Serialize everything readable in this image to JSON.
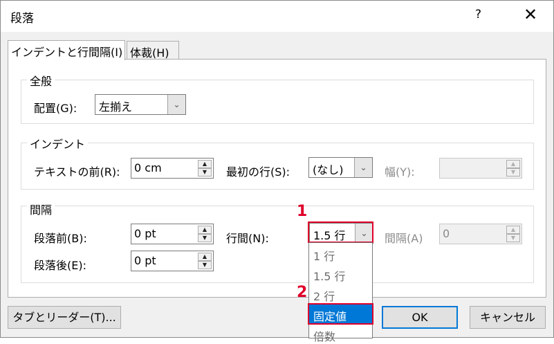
{
  "window": {
    "title": "段落",
    "help": "?",
    "close": "✕"
  },
  "tabs": [
    {
      "label": "インデントと行間隔(I)"
    },
    {
      "label": "体裁(H)"
    }
  ],
  "general": {
    "heading": "全般",
    "alignment_label": "配置(G):",
    "alignment_value": "左揃え"
  },
  "indent": {
    "heading": "インデント",
    "before_text_label": "テキストの前(R):",
    "before_text_value": "0 cm",
    "first_line_label": "最初の行(S):",
    "first_line_value": "(なし)",
    "by_label": "幅(Y):",
    "by_value": ""
  },
  "spacing": {
    "heading": "間隔",
    "before_label": "段落前(B):",
    "before_value": "0 pt",
    "after_label": "段落後(E):",
    "after_value": "0 pt",
    "line_spacing_label": "行間(N):",
    "line_spacing_value": "1.5 行",
    "at_label": "間隔(A)",
    "at_value": "0"
  },
  "line_spacing_options": [
    "1 行",
    "1.5 行",
    "2 行",
    "固定値",
    "倍数"
  ],
  "annotations": {
    "step1": "1",
    "step2": "2"
  },
  "buttons": {
    "tabs": "タブとリーダー(T)...",
    "ok": "OK",
    "cancel": "キャンセル"
  },
  "colors": {
    "annotation_red": "#e0002a",
    "selection_blue": "#0078d7"
  },
  "icons": {
    "dropdown": "chevron-down-icon",
    "spin_up": "spin-up-icon",
    "spin_down": "spin-down-icon",
    "close": "close-icon"
  }
}
